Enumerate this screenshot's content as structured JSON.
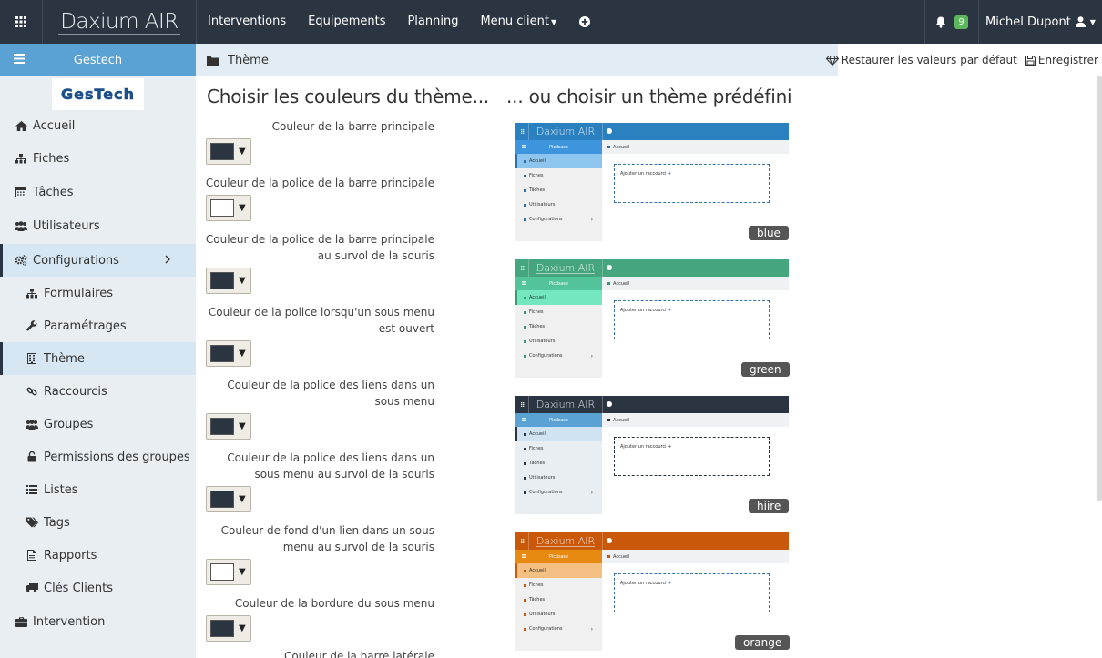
{
  "topbar": {
    "logo": "Daxium AIR",
    "nav": [
      "Interventions",
      "Equipements",
      "Planning",
      "Menu client"
    ],
    "notif_count": "9",
    "user": "Michel Dupont"
  },
  "sidebar": {
    "title": "Gestech",
    "logo_text": "GesTech",
    "items": [
      {
        "label": "Accueil",
        "icon": "home-icon"
      },
      {
        "label": "Fiches",
        "icon": "sitemap-icon"
      },
      {
        "label": "Tâches",
        "icon": "calendar-icon"
      },
      {
        "label": "Utilisateurs",
        "icon": "users-icon"
      },
      {
        "label": "Configurations",
        "icon": "cogs-icon"
      },
      {
        "label": "Formulaires",
        "icon": "sitemap-icon"
      },
      {
        "label": "Paramétrages",
        "icon": "wrench-icon"
      },
      {
        "label": "Thème",
        "icon": "building-icon"
      },
      {
        "label": "Raccourcis",
        "icon": "link-icon"
      },
      {
        "label": "Groupes",
        "icon": "users-icon"
      },
      {
        "label": "Permissions des groupes",
        "icon": "unlock-icon"
      },
      {
        "label": "Listes",
        "icon": "list-icon"
      },
      {
        "label": "Tags",
        "icon": "tags-icon"
      },
      {
        "label": "Rapports",
        "icon": "file-icon"
      },
      {
        "label": "Clés Clients",
        "icon": "truck-icon"
      },
      {
        "label": "Intervention",
        "icon": "briefcase-icon"
      }
    ]
  },
  "header": {
    "title": "Thème",
    "restore_label": "Restaurer les valeurs par défaut",
    "save_label": "Enregistrer"
  },
  "colors_section": {
    "title": "Choisir les couleurs du thème...",
    "fields": [
      {
        "label": "Couleur de la barre principale",
        "value": "#2b3542"
      },
      {
        "label": "Couleur de la police de la barre principale",
        "value": "#ffffff"
      },
      {
        "label": "Couleur de la police de la barre principale au survol de la souris",
        "value": "#2b3542"
      },
      {
        "label": "Couleur de la police lorsqu'un sous menu est ouvert",
        "value": "#2b3542"
      },
      {
        "label": "Couleur de la police des liens dans un sous menu",
        "value": "#2b3542"
      },
      {
        "label": "Couleur de la police des liens dans un sous menu au survol de la souris",
        "value": "#2b3542"
      },
      {
        "label": "Couleur de fond d'un lien dans un sous menu au survol de la souris",
        "value": "#ffffff"
      },
      {
        "label": "Couleur de la bordure du sous menu",
        "value": "#2b3542"
      },
      {
        "label": "Couleur de la barre latérale",
        "value": "#2b3542"
      }
    ]
  },
  "themes_section": {
    "title": "... ou choisir un thème prédéfini",
    "preview": {
      "logo": "Daxium AIR",
      "side_title": "Pictbase",
      "items": [
        "Accueil",
        "Fiches",
        "Tâches",
        "Utilisateurs",
        "Configurations"
      ],
      "breadcrumb": "Accueil",
      "shortcut": "Ajouter un raccourci"
    },
    "themes": [
      {
        "name": "blue",
        "top": "#2b80c0",
        "side_head": "#3d96dd",
        "side": "#f0f0f0",
        "active": "#8ec5ee",
        "icon": "#2b6ea8",
        "box": "#3a6fa8"
      },
      {
        "name": "green",
        "top": "#44a57e",
        "side_head": "#52c39b",
        "side": "#f0f0f0",
        "active": "#74e6c0",
        "icon": "#3a9a74",
        "box": "#3a6fa8"
      },
      {
        "name": "hiire",
        "top": "#2b3542",
        "side_head": "#5ba2d4",
        "side": "#e9eef2",
        "active": "#cfe3f2",
        "icon": "#2b3542",
        "box": "#2b3542"
      },
      {
        "name": "orange",
        "top": "#c9580a",
        "side_head": "#e68a12",
        "side": "#f0f0f0",
        "active": "#f3bf82",
        "icon": "#c9580a",
        "box": "#3a6fa8"
      }
    ]
  }
}
